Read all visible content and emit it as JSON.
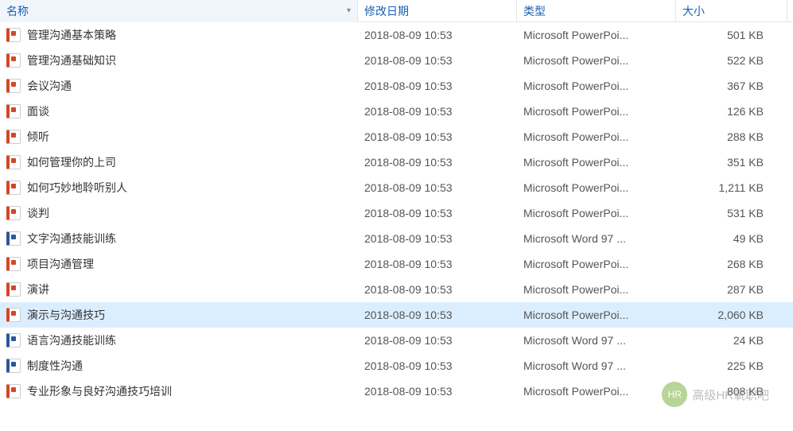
{
  "columns": {
    "name": "名称",
    "date": "修改日期",
    "type": "类型",
    "size": "大小"
  },
  "files": [
    {
      "icon": "pp",
      "name": "管理沟通基本策略",
      "date": "2018-08-09 10:53",
      "type": "Microsoft PowerPoi...",
      "size": "501 KB",
      "selected": false
    },
    {
      "icon": "pp",
      "name": "管理沟通基础知识",
      "date": "2018-08-09 10:53",
      "type": "Microsoft PowerPoi...",
      "size": "522 KB",
      "selected": false
    },
    {
      "icon": "pp",
      "name": "会议沟通",
      "date": "2018-08-09 10:53",
      "type": "Microsoft PowerPoi...",
      "size": "367 KB",
      "selected": false
    },
    {
      "icon": "pp",
      "name": "面谈",
      "date": "2018-08-09 10:53",
      "type": "Microsoft PowerPoi...",
      "size": "126 KB",
      "selected": false
    },
    {
      "icon": "pp",
      "name": "倾听",
      "date": "2018-08-09 10:53",
      "type": "Microsoft PowerPoi...",
      "size": "288 KB",
      "selected": false
    },
    {
      "icon": "pp",
      "name": "如何管理你的上司",
      "date": "2018-08-09 10:53",
      "type": "Microsoft PowerPoi...",
      "size": "351 KB",
      "selected": false
    },
    {
      "icon": "pp",
      "name": "如何巧妙地聆听别人",
      "date": "2018-08-09 10:53",
      "type": "Microsoft PowerPoi...",
      "size": "1,211 KB",
      "selected": false
    },
    {
      "icon": "pp",
      "name": "谈判",
      "date": "2018-08-09 10:53",
      "type": "Microsoft PowerPoi...",
      "size": "531 KB",
      "selected": false
    },
    {
      "icon": "wd",
      "name": "文字沟通技能训练",
      "date": "2018-08-09 10:53",
      "type": "Microsoft Word 97 ...",
      "size": "49 KB",
      "selected": false
    },
    {
      "icon": "pp",
      "name": "项目沟通管理",
      "date": "2018-08-09 10:53",
      "type": "Microsoft PowerPoi...",
      "size": "268 KB",
      "selected": false
    },
    {
      "icon": "pp",
      "name": "演讲",
      "date": "2018-08-09 10:53",
      "type": "Microsoft PowerPoi...",
      "size": "287 KB",
      "selected": false
    },
    {
      "icon": "pp",
      "name": "演示与沟通技巧",
      "date": "2018-08-09 10:53",
      "type": "Microsoft PowerPoi...",
      "size": "2,060 KB",
      "selected": true
    },
    {
      "icon": "wd",
      "name": "语言沟通技能训练",
      "date": "2018-08-09 10:53",
      "type": "Microsoft Word 97 ...",
      "size": "24 KB",
      "selected": false
    },
    {
      "icon": "wd",
      "name": "制度性沟通",
      "date": "2018-08-09 10:53",
      "type": "Microsoft Word 97 ...",
      "size": "225 KB",
      "selected": false
    },
    {
      "icon": "pp",
      "name": "专业形象与良好沟通技巧培训",
      "date": "2018-08-09 10:53",
      "type": "Microsoft PowerPoi...",
      "size": "808 KB",
      "selected": false
    }
  ],
  "watermark": {
    "text": "高级HR氧职吧"
  }
}
